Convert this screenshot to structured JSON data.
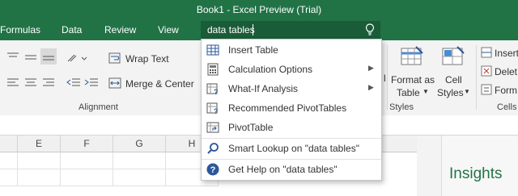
{
  "window": {
    "title": "Book1 - Excel Preview (Trial)"
  },
  "tabs": [
    "Formulas",
    "Data",
    "Review",
    "View"
  ],
  "tellme": {
    "value": "data tables"
  },
  "ribbon": {
    "wrap_text": "Wrap Text",
    "merge_center": "Merge & Center",
    "alignment_group": "Alignment",
    "format_as_table_line1": "Format as",
    "format_as_table_line2": "Table",
    "cell_styles_line1": "Cell",
    "cell_styles_line2": "Styles",
    "styles_group": "Styles",
    "insert": "Insert",
    "delete": "Delet",
    "format": "Form",
    "cells_group": "Cells",
    "partial_l": "l"
  },
  "grid": {
    "columns": [
      "E",
      "F",
      "G",
      "H"
    ]
  },
  "insights": {
    "title": "Insights"
  },
  "menu": {
    "items": [
      {
        "label": "Insert Table",
        "icon": "table-icon",
        "submenu": false
      },
      {
        "label": "Calculation Options",
        "icon": "calculator-icon",
        "submenu": true
      },
      {
        "label": "What-If Analysis",
        "icon": "what-if-icon",
        "submenu": true
      },
      {
        "label": "Recommended PivotTables",
        "icon": "recommended-pivot-icon",
        "submenu": false
      },
      {
        "label": "PivotTable",
        "icon": "pivottable-icon",
        "submenu": false
      }
    ],
    "smart_lookup": "Smart Lookup on \"data tables\"",
    "get_help": "Get Help on \"data tables\""
  },
  "colors": {
    "accent": "#217346",
    "help_blue": "#2b579a"
  }
}
